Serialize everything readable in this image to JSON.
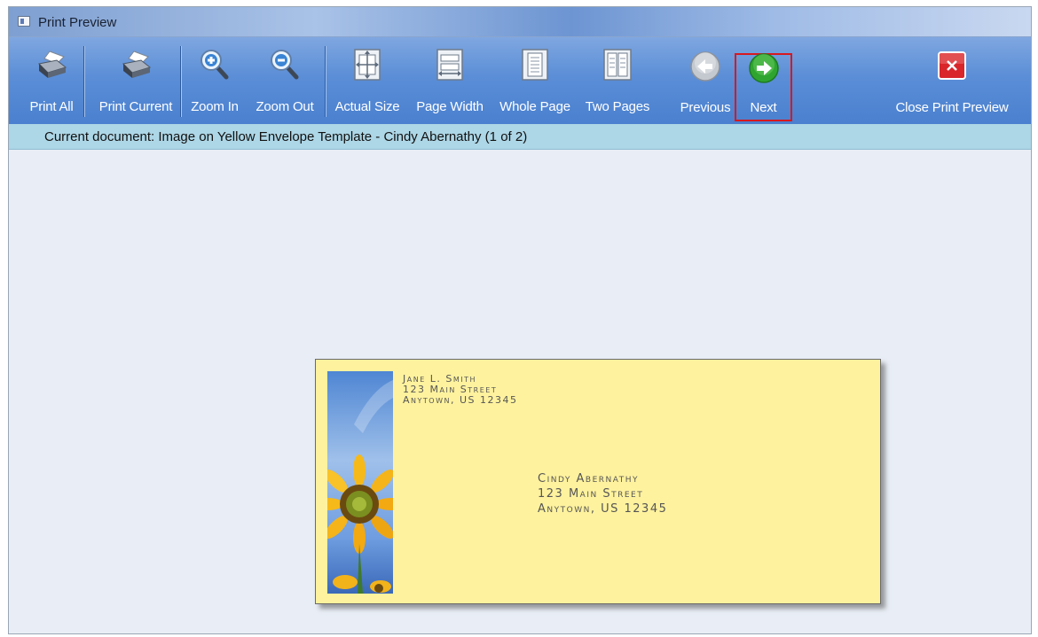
{
  "window": {
    "title": "Print Preview"
  },
  "toolbar": {
    "print_all": "Print All",
    "print_current": "Print Current",
    "zoom_in": "Zoom In",
    "zoom_out": "Zoom Out",
    "actual_size": "Actual Size",
    "page_width": "Page Width",
    "whole_page": "Whole Page",
    "two_pages": "Two Pages",
    "previous": "Previous",
    "next": "Next",
    "close": "Close Print Preview"
  },
  "status": {
    "text": "Current document:  Image on Yellow Envelope Template - Cindy Abernathy  (1 of 2)"
  },
  "envelope": {
    "return_address": [
      "Jane L. Smith",
      "123 Main Street",
      "Anytown, US 12345"
    ],
    "recipient_address": [
      "Cindy Abernathy",
      "123 Main Street",
      "Anytown, US 12345"
    ]
  },
  "colors": {
    "envelope": "#fff29e",
    "toolbar": "#5b8ed7",
    "status_bar": "#add6e6",
    "highlight": "#d8181f"
  }
}
